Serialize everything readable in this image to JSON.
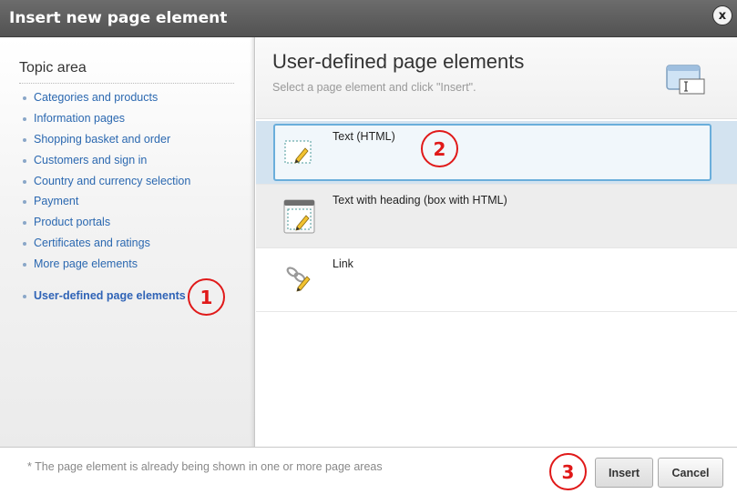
{
  "dialog": {
    "title": "Insert new page element",
    "close_label": "x"
  },
  "sidebar": {
    "heading": "Topic area",
    "items": [
      {
        "label": "Categories and products"
      },
      {
        "label": "Information pages"
      },
      {
        "label": "Shopping basket and order"
      },
      {
        "label": "Customers and sign in"
      },
      {
        "label": "Country and currency selection"
      },
      {
        "label": "Payment"
      },
      {
        "label": "Product portals"
      },
      {
        "label": "Certificates and ratings"
      },
      {
        "label": "More page elements"
      },
      {
        "label": "User-defined page elements",
        "active": true
      }
    ]
  },
  "main": {
    "title": "User-defined page elements",
    "subtitle": "Select a page element and click \"Insert\".",
    "elements": [
      {
        "label": "Text (HTML)",
        "icon": "text-html-icon",
        "selected": true
      },
      {
        "label": "Text with heading (box with HTML)",
        "icon": "text-heading-box-icon",
        "selected": false
      },
      {
        "label": "Link",
        "icon": "link-icon",
        "selected": false
      }
    ]
  },
  "footer": {
    "note": "* The page element is already being shown in one or more page areas",
    "insert_label": "Insert",
    "cancel_label": "Cancel"
  },
  "markers": [
    "1",
    "2",
    "3"
  ],
  "colors": {
    "titlebar": "#5e5e5e",
    "link": "#2b68b0",
    "selected_row": "#d3e3f0",
    "selected_border": "#6aaedb",
    "marker": "#e01919"
  }
}
